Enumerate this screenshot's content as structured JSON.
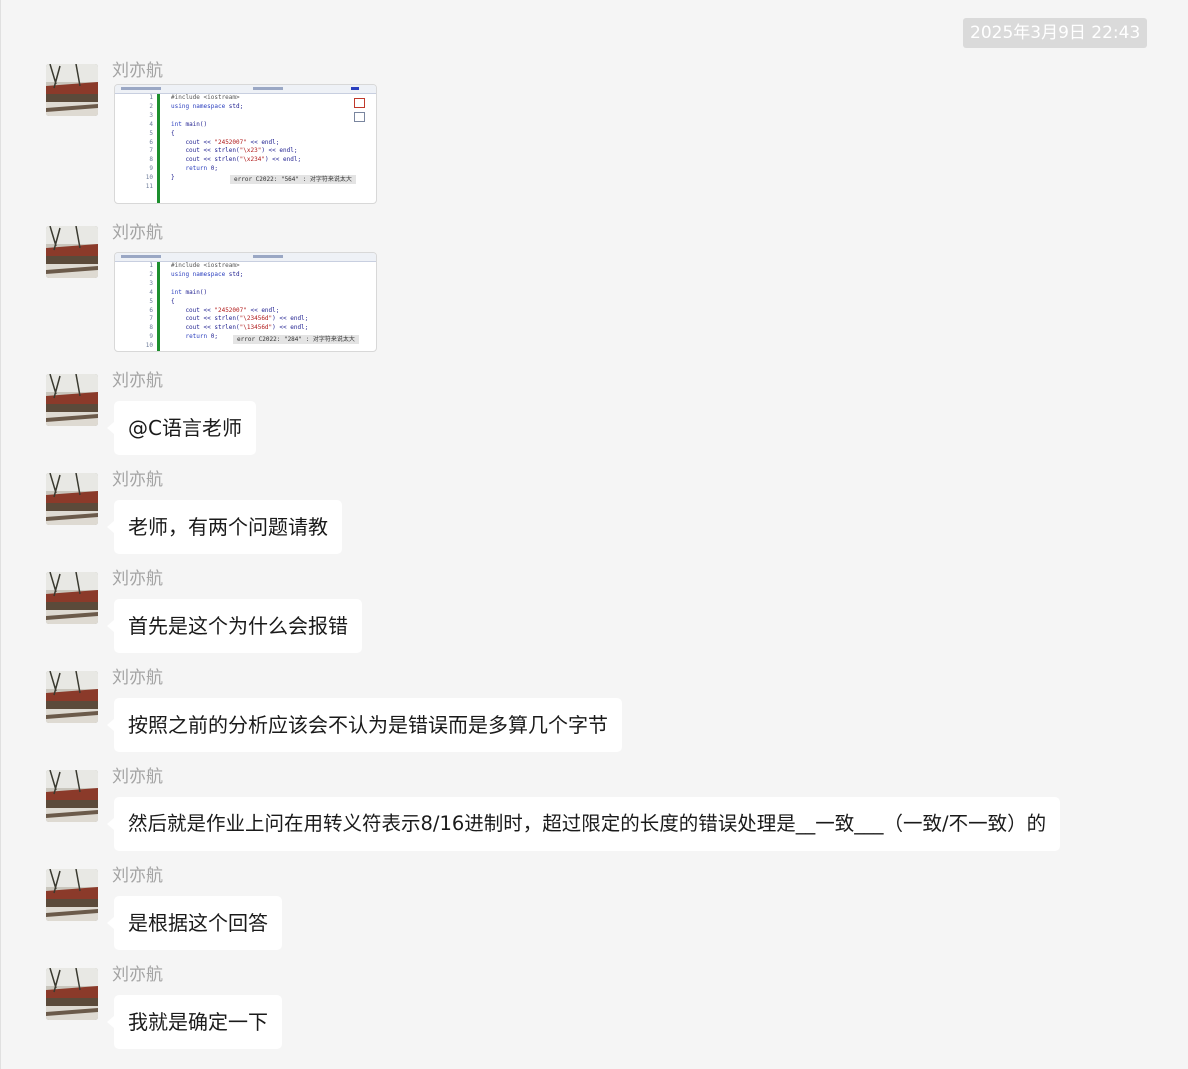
{
  "timestamp": "2025年3月9日 22:43",
  "messages": [
    {
      "sender": "刘亦航",
      "type": "image",
      "screenshot": {
        "line_numbers": [
          "1",
          "2",
          "3",
          "4",
          "5",
          "6",
          "7",
          "8",
          "9",
          "10",
          "11"
        ],
        "error_text": "error C2022: \"564\" : 对字符来说太大"
      }
    },
    {
      "sender": "刘亦航",
      "type": "image",
      "screenshot": {
        "line_numbers": [
          "1",
          "2",
          "3",
          "4",
          "5",
          "6",
          "7",
          "8",
          "9",
          "10"
        ],
        "error_text": "error C2022: \"284\" : 对字符来说太大"
      }
    },
    {
      "sender": "刘亦航",
      "type": "text",
      "text": "@C语言老师"
    },
    {
      "sender": "刘亦航",
      "type": "text",
      "text": "老师，有两个问题请教"
    },
    {
      "sender": "刘亦航",
      "type": "text",
      "text": "首先是这个为什么会报错"
    },
    {
      "sender": "刘亦航",
      "type": "text",
      "text": "按照之前的分析应该会不认为是错误而是多算几个字节"
    },
    {
      "sender": "刘亦航",
      "type": "text",
      "text": "然后就是作业上问在用转义符表示8/16进制时，超过限定的长度的错误处理是__一致___（一致/不一致）的"
    },
    {
      "sender": "刘亦航",
      "type": "text",
      "text": "是根据这个回答"
    },
    {
      "sender": "刘亦航",
      "type": "text",
      "text": "我就是确定一下"
    }
  ]
}
